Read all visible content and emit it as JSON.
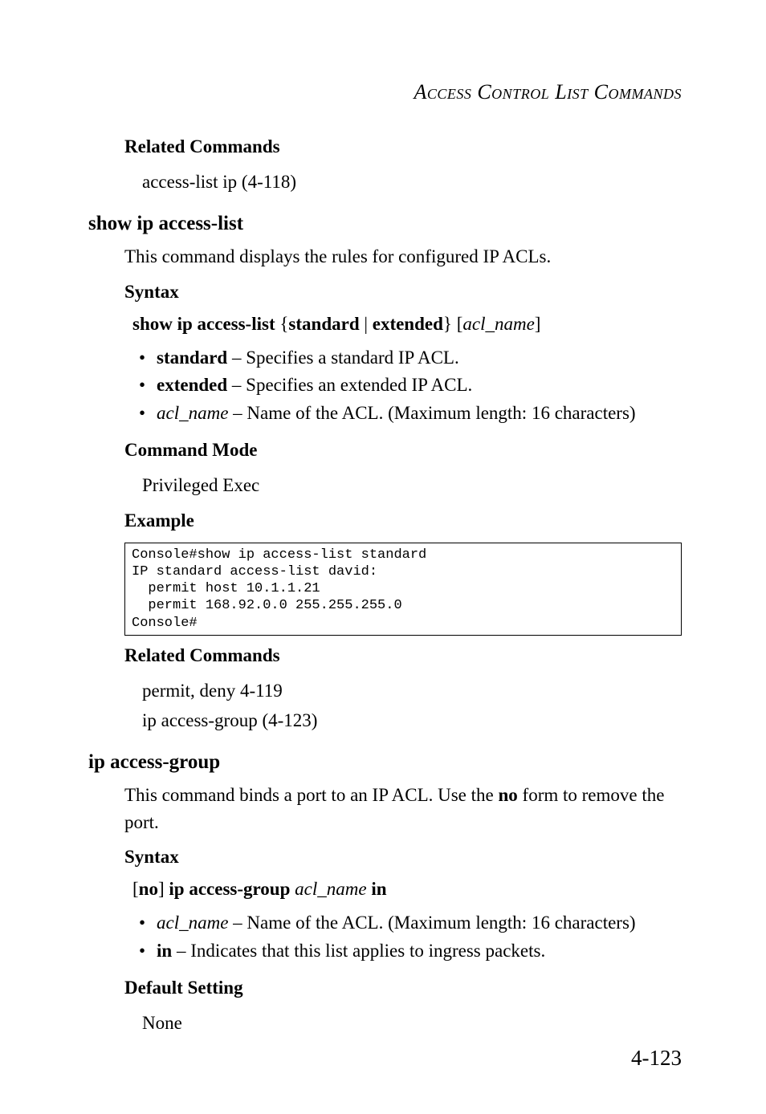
{
  "running_head": "Access Control List Commands",
  "page_number": "4-123",
  "sec1": {
    "related_heading": "Related Commands",
    "related_text": "access-list ip (4-118)"
  },
  "cmd1": {
    "title": "show ip access-list",
    "desc": "This command displays the rules for configured IP ACLs.",
    "syntax_heading": "Syntax",
    "syntax_prefix_bold": "show ip access-list",
    "brace_open": " {",
    "standard": "standard",
    "pipe": " | ",
    "extended": "extended",
    "brace_close": "} [",
    "aclname": "acl_name",
    "close_bracket": "]",
    "bullets": {
      "b1_bold": "standard",
      "b1_rest": " – Specifies a standard IP ACL.",
      "b2_bold": "extended",
      "b2_rest": " – Specifies an extended IP ACL.",
      "b3_ital": "acl_name",
      "b3_rest": " – Name of the ACL. (Maximum length: 16 characters)"
    },
    "mode_heading": "Command Mode",
    "mode_text": "Privileged Exec",
    "example_heading": "Example",
    "example_code": "Console#show ip access-list standard\nIP standard access-list david:\n  permit host 10.1.1.21\n  permit 168.92.0.0 255.255.255.0\nConsole#",
    "related_heading": "Related Commands",
    "related_l1": "permit, deny 4-119",
    "related_l2": "ip access-group (4-123)"
  },
  "cmd2": {
    "title": "ip access-group",
    "desc_part1": "This command binds a port to an IP ACL. Use the ",
    "desc_bold": "no",
    "desc_part2": " form to remove the port.",
    "syntax_heading": "Syntax",
    "bracket_open": "[",
    "no": "no",
    "bracket_close": "] ",
    "cmd_bold": "ip access-group",
    "space": " ",
    "aclname": "acl_name",
    "space2": " ",
    "in": "in",
    "bullets": {
      "b1_ital": "acl_name",
      "b1_rest": " – Name of the ACL. (Maximum length: 16 characters)",
      "b2_bold": "in",
      "b2_rest": " – Indicates that this list applies to ingress packets."
    },
    "default_heading": "Default Setting",
    "default_text": "None"
  }
}
